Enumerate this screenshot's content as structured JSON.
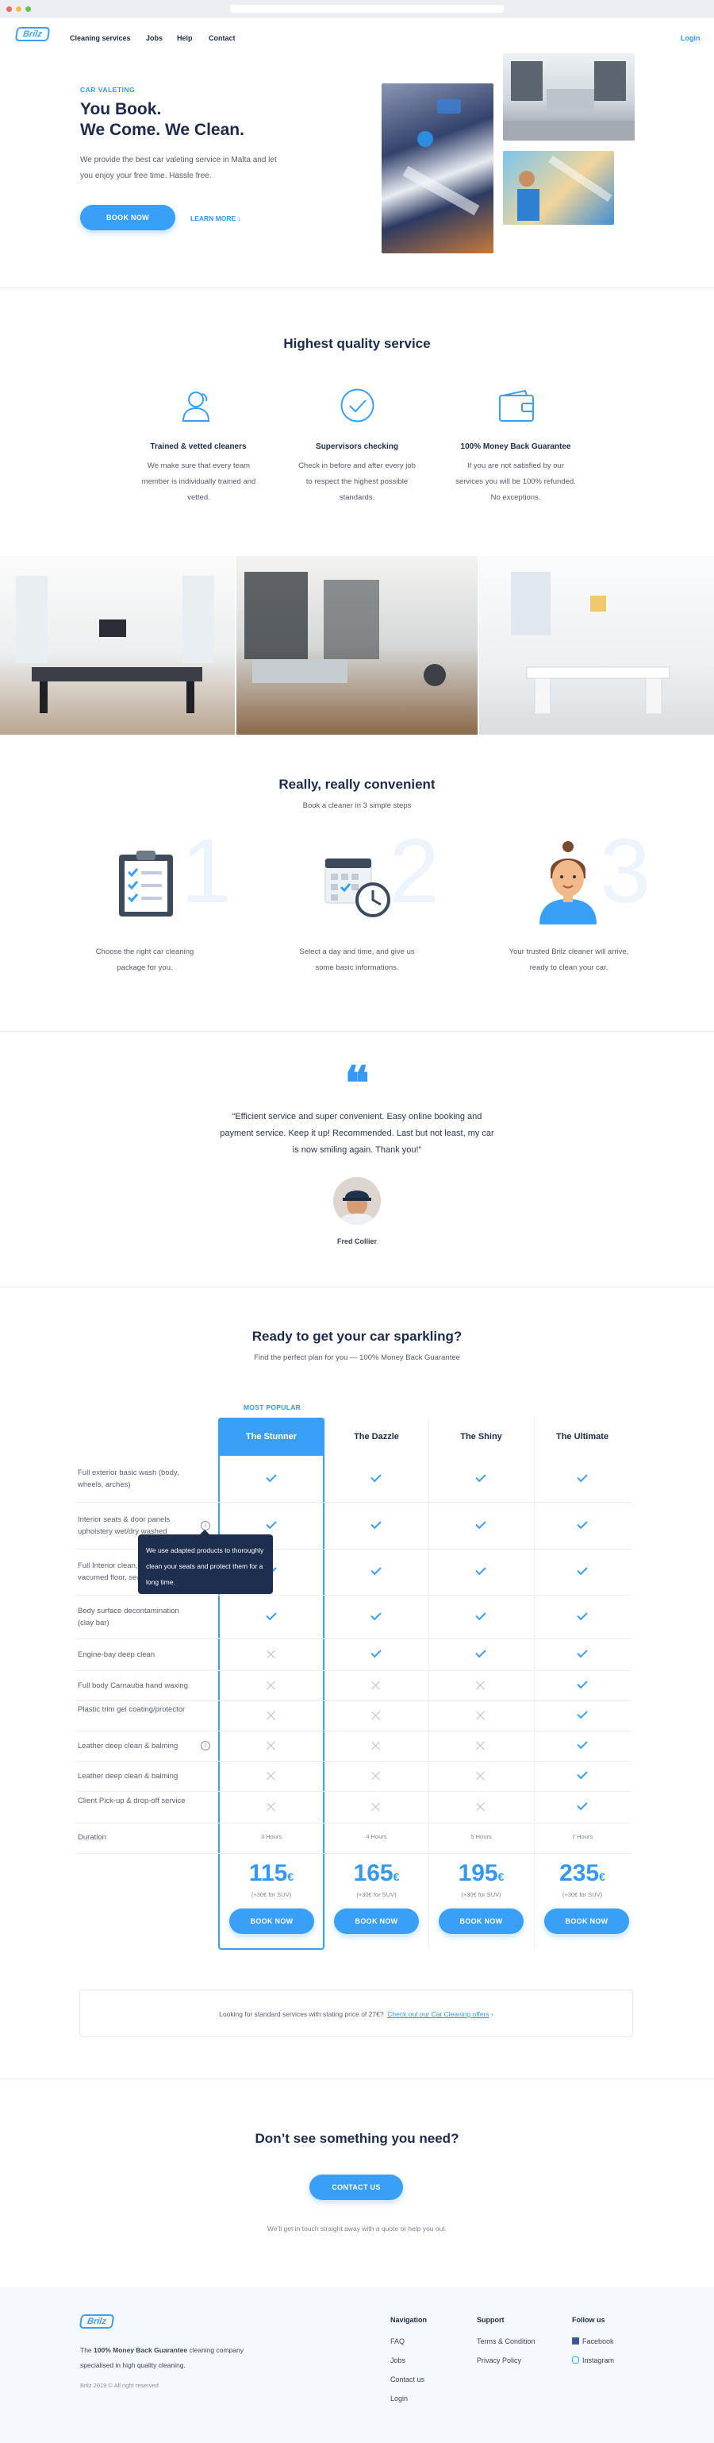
{
  "window": {
    "dots": [
      "#ed6a5e",
      "#f5bf4f",
      "#61c554"
    ]
  },
  "nav": {
    "logo": "Brilz",
    "items": [
      "Cleaning services",
      "Jobs",
      "Help",
      "Contact"
    ],
    "login": "Login"
  },
  "hero": {
    "eyebrow": "CAR VALETING",
    "title_line1": "You Book.",
    "title_line2": "We Come. We Clean.",
    "desc": "We provide the best car valeting service in Malta and let you enjoy your free time. Hassle free.",
    "book": "BOOK NOW",
    "learn": "LEARN MORE"
  },
  "quality": {
    "title": "Highest quality service",
    "items": [
      {
        "icon": "user-icon",
        "title": "Trained & vetted cleaners",
        "text": "We make sure that every team member is individually trained and vetted."
      },
      {
        "icon": "check-circle-icon",
        "title": "Supervisors checking",
        "text": "Check in before and after every job to respect the highest possible standards."
      },
      {
        "icon": "wallet-icon",
        "title": "100% Money Back Guarantee",
        "text": "If you are not satisfied by our services you will be 100% refunded. No exceptions."
      }
    ]
  },
  "convenient": {
    "title": "Really, really convenient",
    "subtitle": "Book a cleaner in 3 simple steps",
    "steps": [
      {
        "num": "1",
        "icon": "clipboard-icon",
        "text": "Choose the right car cleaning package for you."
      },
      {
        "num": "2",
        "icon": "calendar-icon",
        "text": "Select a day and time, and give us some basic informations."
      },
      {
        "num": "3",
        "icon": "cleaner-avatar-icon",
        "text": "Your trusted Brilz cleaner will arrive, ready to clean your car."
      }
    ]
  },
  "testimonial": {
    "quote": "“Efficient service and super convenient. Easy online booking and payment service. Keep it up! Recommended. Last but not least, my car is now smiling again. Thank you!”",
    "author": "Fred Collier"
  },
  "pricing": {
    "title": "Ready to get your car sparkling?",
    "subtitle": "Find the perfect plan for you — 100% Money Back Guarantee",
    "popular": "MOST POPULAR",
    "plans": [
      {
        "name": "The Stunner",
        "duration": "3 Hours",
        "price": "115",
        "currency": "€",
        "note": "(+30€ for SUV)",
        "button": "BOOK NOW"
      },
      {
        "name": "The Dazzle",
        "duration": "4 Hours",
        "price": "165",
        "currency": "€",
        "note": "(+30€ for SUV)",
        "button": "BOOK NOW"
      },
      {
        "name": "The Shiny",
        "duration": "5 Hours",
        "price": "195",
        "currency": "€",
        "note": "(+30€ for SUV)",
        "button": "BOOK NOW"
      },
      {
        "name": "The Ultimate",
        "duration": "7 Hours",
        "price": "235",
        "currency": "€",
        "note": "(+30€ for SUV)",
        "button": "BOOK NOW"
      }
    ],
    "features": [
      {
        "label": "Full exterior basic wash (body, wheels, arches)",
        "marks": [
          1,
          1,
          1,
          1
        ]
      },
      {
        "label": "Interior seats & door panels upholstery wet/dry washed",
        "marks": [
          1,
          1,
          1,
          1
        ],
        "info": true
      },
      {
        "label": "Full Interior clean, dusted & vacumed floor, seats and boot",
        "marks": [
          1,
          1,
          1,
          1
        ]
      },
      {
        "label": "Body surface decontamination (clay bar)",
        "marks": [
          1,
          1,
          1,
          1
        ]
      },
      {
        "label": "Engine-bay deep clean",
        "marks": [
          0,
          1,
          1,
          1
        ]
      },
      {
        "label": "Full body Carnauba hand waxing",
        "marks": [
          0,
          0,
          0,
          1
        ]
      },
      {
        "label": "Plastic trim gel coating/protector",
        "marks": [
          0,
          0,
          0,
          1
        ]
      },
      {
        "label": "Leather deep clean & balming",
        "marks": [
          0,
          0,
          0,
          1
        ],
        "info": true
      },
      {
        "label": "Leather deep clean & balming",
        "marks": [
          0,
          0,
          0,
          1
        ]
      },
      {
        "label": "Client Pick-up & drop-off service",
        "marks": [
          0,
          0,
          0,
          1
        ]
      }
    ],
    "duration_label": "Duration",
    "tooltip": "We use adapted products to thoroughly clean your seats and protect them for a long time.",
    "offer_text": "Looking for standard services with stating price of 27€?",
    "offer_link": "Check out our Car Cleaning offers"
  },
  "contact": {
    "title": "Don’t see something you need?",
    "button": "CONTACT US",
    "note": "We’ll get in touch straight away with a quote or help you out."
  },
  "footer": {
    "logo": "Brilz",
    "desc_pre": "The ",
    "desc_bold": "100% Money Back Guarantee",
    "desc_post": " cleaning company specialised in high quality cleaning.",
    "copyright": "Brilz 2019 © All right reserved",
    "cols": [
      {
        "title": "Navigation",
        "links": [
          "FAQ",
          "Jobs",
          "Contact us",
          "Login"
        ]
      },
      {
        "title": "Support",
        "links": [
          "Terms & Condition",
          "Privacy Policy"
        ]
      },
      {
        "title": "Follow us",
        "links": [
          "Facebook",
          "Instagram"
        ]
      }
    ]
  }
}
